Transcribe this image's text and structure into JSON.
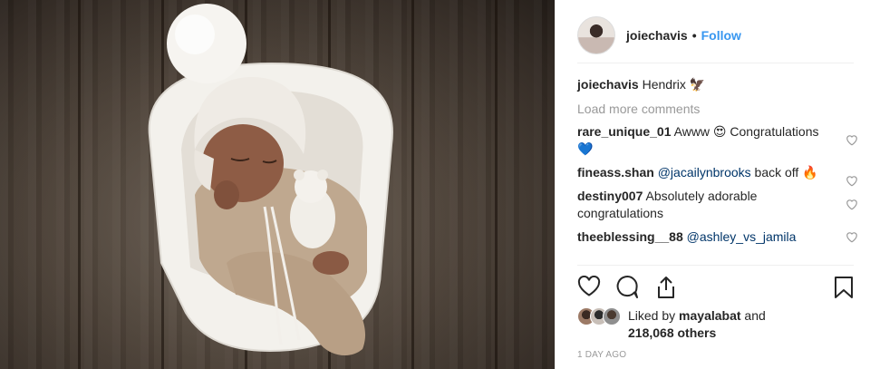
{
  "post": {
    "image_icon": "photo-newborn-in-chair"
  },
  "header": {
    "username": "joiechavis",
    "separator": "•",
    "follow_label": "Follow"
  },
  "caption": {
    "username": "joiechavis",
    "text": "Hendrix 🦅"
  },
  "load_more_label": "Load more comments",
  "comments": [
    {
      "username": "rare_unique_01",
      "text": "Awww 😍 Congratulations 💙"
    },
    {
      "username": "fineass.shan",
      "mention": "@jacailynbrooks",
      "text": " back off 🔥"
    },
    {
      "username": "destiny007",
      "text": "Absolutely adorable congratulations"
    },
    {
      "username": "theeblessing__88",
      "mention": "@ashley_vs_jamila",
      "text": ""
    }
  ],
  "likes": {
    "prefix": "Liked by ",
    "user": "mayalabat",
    "middle": " and",
    "count": "218,068 others"
  },
  "timestamp": "1 DAY AGO",
  "colors": {
    "link": "#3897f0",
    "mention": "#003569",
    "muted": "#999999"
  },
  "icons": [
    "heart-icon",
    "comment-icon",
    "share-icon",
    "bookmark-icon",
    "small-heart-icon"
  ]
}
